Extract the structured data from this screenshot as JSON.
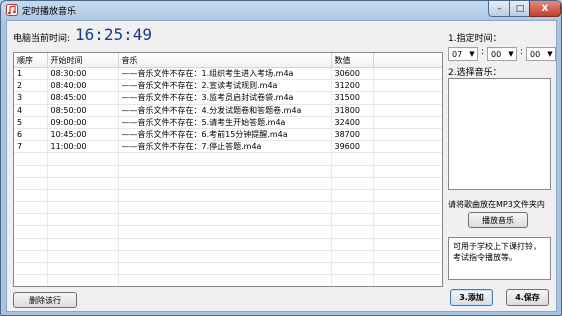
{
  "window": {
    "title": "定时播放音乐",
    "minimize_glyph": "–",
    "maximize_glyph": "□",
    "close_glyph": "X",
    "icon": "music-app-icon"
  },
  "clock": {
    "label": "电脑当前时间:",
    "value": "16:25:49"
  },
  "table": {
    "headers": [
      "顺序",
      "开始时间",
      "音乐",
      "数值",
      ""
    ],
    "rows": [
      [
        "1",
        "08:30:00",
        "——音乐文件不存在：1.组织考生进入考场.m4a",
        "30600"
      ],
      [
        "2",
        "08:40:00",
        "——音乐文件不存在：2.宣读考试规则.m4a",
        "31200"
      ],
      [
        "3",
        "08:45:00",
        "——音乐文件不存在：3.监考员启封试卷袋.m4a",
        "31500"
      ],
      [
        "4",
        "08:50:00",
        "——音乐文件不存在：4.分发试题卷和答题卷.m4a",
        "31800"
      ],
      [
        "5",
        "09:00:00",
        "——音乐文件不存在：5.请考生开始答题.m4a",
        "32400"
      ],
      [
        "6",
        "10:45:00",
        "——音乐文件不存在：6.考前15分钟提醒.m4a",
        "38700"
      ],
      [
        "7",
        "11:00:00",
        "——音乐文件不存在：7.停止答题.m4a",
        "39600"
      ]
    ]
  },
  "delete_button": "删除该行",
  "schedule": {
    "step1_label": "1.指定时间：",
    "hour": "07",
    "minute": "00",
    "second": "00",
    "separator": ":"
  },
  "music": {
    "step2_label": "2.选择音乐：",
    "hint": "请将歌曲放在MP3文件夹内",
    "play_button": "播放音乐"
  },
  "note": "可用于学校上下课打铃，考试指令播放等。",
  "buttons": {
    "add": "3.添加",
    "save": "4.保存"
  },
  "colors": {
    "clock_text": "#163a8a",
    "close_button": "#c1412b",
    "window_frame": "#a9c3e0"
  }
}
